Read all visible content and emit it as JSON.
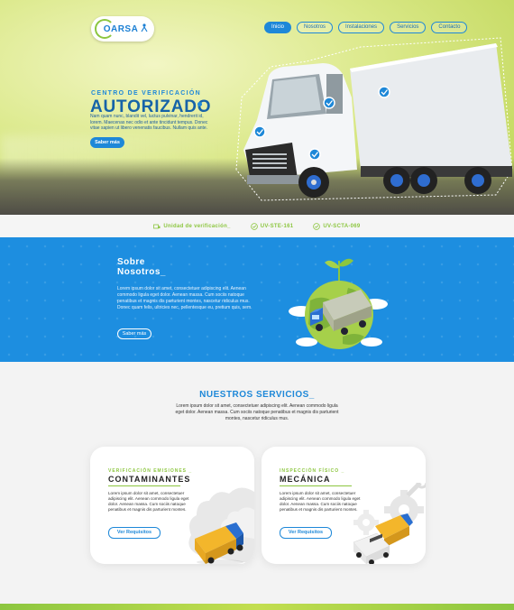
{
  "header": {
    "logo_text": "OARSA",
    "nav": [
      "Inicio",
      "Nosotros",
      "Instalaciones",
      "Servicios",
      "Contacto"
    ]
  },
  "hero": {
    "subtitle": "CENTRO DE VERIFICACIÓN",
    "title": "AUTORIZADO",
    "text": "Nam quam nunc, blandit vel, luctus pulvinar, hendrerit id, lorem. Maecenas nec odio et ante tincidunt tempus. Donec vitae sapien ut libero venenatis faucibus. Nullam quis ante.",
    "button": "Saber más"
  },
  "infobar": {
    "items": [
      "Unidad de verificación_",
      "UV-STE-161",
      "UV-SCTA-069"
    ]
  },
  "about": {
    "title": "Sobre\nNosotros_",
    "text": "Lorem ipsum dolor sit amet, consectetuer adipiscing elit. Aenean commodo ligula eget dolor. Aenean massa. Cum sociis natoque penatibus et magnis dis parturient montes, nascetur ridiculus mus. Donec quam felis, ultricies nec, pellentesque eu, pretium quis, sem.",
    "button": "Saber más"
  },
  "services": {
    "title": "NUESTROS SERVICIOS_",
    "intro": "Lorem ipsum dolor sit amet, consectetuer adipiscing elit. Aenean commodo ligula eget dolor. Aenean massa. Cum sociis natoque penatibus et magnis dis parturient montes, nascetur ridiculus mus.",
    "cards": [
      {
        "subtitle": "Verificación Emisiones _",
        "title": "CONTAMINANTES",
        "text": "Lorem ipsum dolor sit amet, consectetuer adipiscing elit. Aenean commodo ligula eget dolor. Aenean massa. Cum sociis natoque penatibus et magnis dis parturient montes.",
        "button": "Ver Requisitos"
      },
      {
        "subtitle": "Inspección Físico _",
        "title": "MECÁNICA",
        "text": "Lorem ipsum dolor sit amet, consectetuer adipiscing elit. Aenean commodo ligula eget dolor. Aenean massa. Cum sociis natoque penatibus et magnis dis parturient montes.",
        "button": "Ver Requisitos"
      }
    ]
  },
  "colors": {
    "brand_blue": "#1e88d8",
    "brand_green": "#8cc63f",
    "dark_blue": "#1663a8"
  }
}
